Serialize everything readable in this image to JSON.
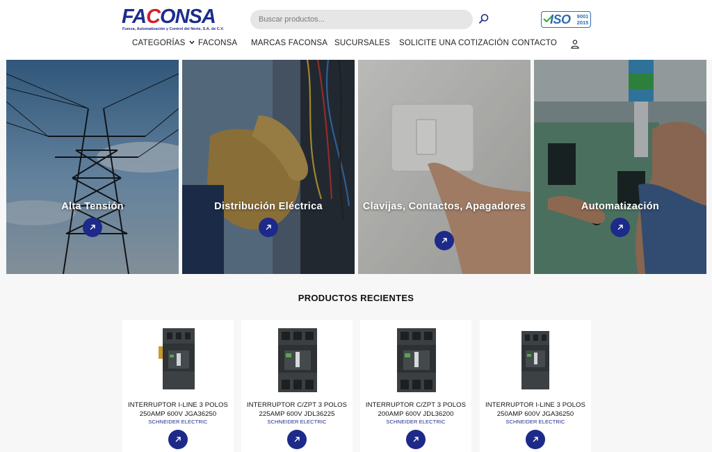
{
  "brand": {
    "logo_main": "FACONSA",
    "logo_tagline": "Fuerza, Automatización y Control del Norte, S.A. de C.V.",
    "iso_label": "ISO",
    "iso_standard": "9001",
    "iso_year": "2015"
  },
  "search": {
    "placeholder": "Buscar productos...",
    "icon": "search-icon"
  },
  "nav": {
    "items": [
      {
        "label": "CATEGORÍAS",
        "has_dropdown": true
      },
      {
        "label": "FACONSA"
      },
      {
        "label": "MARCAS FACONSA"
      },
      {
        "label": "SUCURSALES"
      },
      {
        "label": "SOLICITE UNA COTIZACIÓN"
      },
      {
        "label": "CONTACTO"
      }
    ],
    "account_icon": "user-icon"
  },
  "categories": [
    {
      "title": "Alta Tensión",
      "image": "power-tower-photo"
    },
    {
      "title": "Distribución Eléctrica",
      "image": "electrician-gloves-photo"
    },
    {
      "title": "Clavijas, Contactos, Apagadores",
      "image": "light-switch-photo"
    },
    {
      "title": "Automatización",
      "image": "control-panel-photo"
    }
  ],
  "recent_products": {
    "title": "PRODUCTOS RECIENTES",
    "items": [
      {
        "name": "INTERRUPTOR I-LINE 3 POLOS 250AMP 600V JGA36250",
        "brand": "SCHNEIDER ELECTRIC"
      },
      {
        "name": "INTERRUPTOR C/ZPT 3 POLOS 225AMP 600V JDL36225",
        "brand": "SCHNEIDER ELECTRIC"
      },
      {
        "name": "INTERRUPTOR C/ZPT 3 POLOS 200AMP 600V JDL36200",
        "brand": "SCHNEIDER ELECTRIC"
      },
      {
        "name": "INTERRUPTOR I-LINE 3 POLOS 250AMP 600V JGA36250",
        "brand": "SCHNEIDER ELECTRIC"
      }
    ]
  },
  "colors": {
    "brand_blue": "#1d2a8a",
    "brand_red": "#d21f2b",
    "iso_blue": "#2d6cb5"
  }
}
